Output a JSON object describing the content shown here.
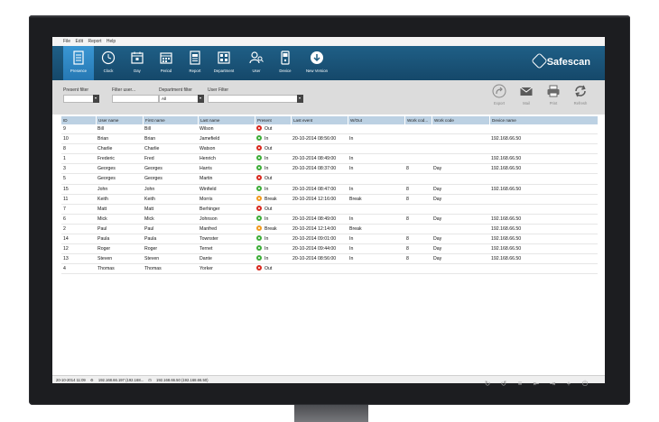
{
  "menu": [
    "File",
    "Edit",
    "Report",
    "Help"
  ],
  "toolbar": [
    {
      "label": "Presence",
      "icon": "presence-list-icon",
      "active": true
    },
    {
      "label": "Clock",
      "icon": "clock-icon"
    },
    {
      "label": "Day",
      "icon": "calendar-day-icon"
    },
    {
      "label": "Period",
      "icon": "calendar-period-icon"
    },
    {
      "label": "Report",
      "icon": "report-icon"
    },
    {
      "label": "Department",
      "icon": "department-icon"
    },
    {
      "label": "User",
      "icon": "user-icon"
    },
    {
      "label": "Device",
      "icon": "device-icon"
    },
    {
      "label": "New Version",
      "icon": "download-icon"
    }
  ],
  "brand": "Safescan",
  "filters": {
    "present_label": "Present filter",
    "user_label": "Filter user...",
    "department_label": "Department filter",
    "department_value": "All",
    "userfilter_label": "User Filter"
  },
  "actions": [
    {
      "label": "Export",
      "icon": "export-icon"
    },
    {
      "label": "Mail",
      "icon": "mail-icon"
    },
    {
      "label": "Print",
      "icon": "print-icon"
    },
    {
      "label": "Refresh",
      "icon": "refresh-icon"
    }
  ],
  "colors": {
    "in": "#3fae3a",
    "out": "#d92b20",
    "break": "#f19a1e",
    "header": "#bcd1e3",
    "toolbar": "#1b5a80",
    "active_tab": "#2f8ac8"
  },
  "table": {
    "columns": [
      "ID",
      "User name",
      "First name",
      "Last name",
      "Present",
      "Last event",
      "W/Out",
      "Work cod...",
      "Work code",
      "Device name"
    ],
    "rows": [
      [
        "9",
        "Bill",
        "Bill",
        "Wilson",
        "Out",
        "",
        "",
        "",
        "",
        ""
      ],
      [
        "10",
        "Brian",
        "Brian",
        "Jamefield",
        "In",
        "20-10-2014 08:56:00",
        "In",
        "",
        "",
        "192.168.66.50"
      ],
      [
        "8",
        "Charlie",
        "Charlie",
        "Watson",
        "Out",
        "",
        "",
        "",
        "",
        ""
      ],
      [
        "1",
        "Frederic",
        "Fred",
        "Henrich",
        "In",
        "20-10-2014 08:49:00",
        "In",
        "",
        "",
        "192.168.66.50"
      ],
      [
        "3",
        "Georges",
        "Georges",
        "Harris",
        "In",
        "20-10-2014 08:37:00",
        "In",
        "8",
        "Day",
        "192.168.66.50"
      ],
      [
        "5",
        "Georges",
        "Georges",
        "Martin",
        "Out",
        "",
        "",
        "",
        "",
        ""
      ],
      [
        "15",
        "John",
        "John",
        "Winfield",
        "In",
        "20-10-2014 08:47:00",
        "In",
        "8",
        "Day",
        "192.168.66.50"
      ],
      [
        "11",
        "Keith",
        "Keith",
        "Morris",
        "Break",
        "20-10-2014 12:16:00",
        "Break",
        "8",
        "Day",
        ""
      ],
      [
        "7",
        "Matt",
        "Matt",
        "Berhinger",
        "Out",
        "",
        "",
        "",
        "",
        ""
      ],
      [
        "6",
        "Mick",
        "Mick",
        "Johnson",
        "In",
        "20-10-2014 08:49:00",
        "In",
        "8",
        "Day",
        "192.168.66.50"
      ],
      [
        "2",
        "Paul",
        "Paul",
        "Manfred",
        "Break",
        "20-10-2014 12:14:00",
        "Break",
        "",
        "",
        "192.168.66.50"
      ],
      [
        "14",
        "Paula",
        "Paula",
        "Townster",
        "In",
        "20-10-2014 09:01:00",
        "In",
        "8",
        "Day",
        "192.168.66.50"
      ],
      [
        "12",
        "Roger",
        "Roger",
        "Ternet",
        "In",
        "20-10-2014 09:44:00",
        "In",
        "8",
        "Day",
        "192.168.66.50"
      ],
      [
        "13",
        "Steven",
        "Steven",
        "Dante",
        "In",
        "20-10-2014 08:56:00",
        "In",
        "8",
        "Day",
        "192.168.66.50"
      ],
      [
        "4",
        "Thomas",
        "Thomas",
        "Yorker",
        "Out",
        "",
        "",
        "",
        "",
        ""
      ]
    ]
  },
  "status": {
    "date": "20-10-2014 11:09",
    "conn1": "192.168.66.197 (192.168...",
    "conn2": "192.168.66.50 (192.168.66.50)"
  },
  "monitor_buttons": [
    "↻",
    "↺",
    "≡",
    "⇤",
    "⇥",
    "+",
    "⏻"
  ]
}
